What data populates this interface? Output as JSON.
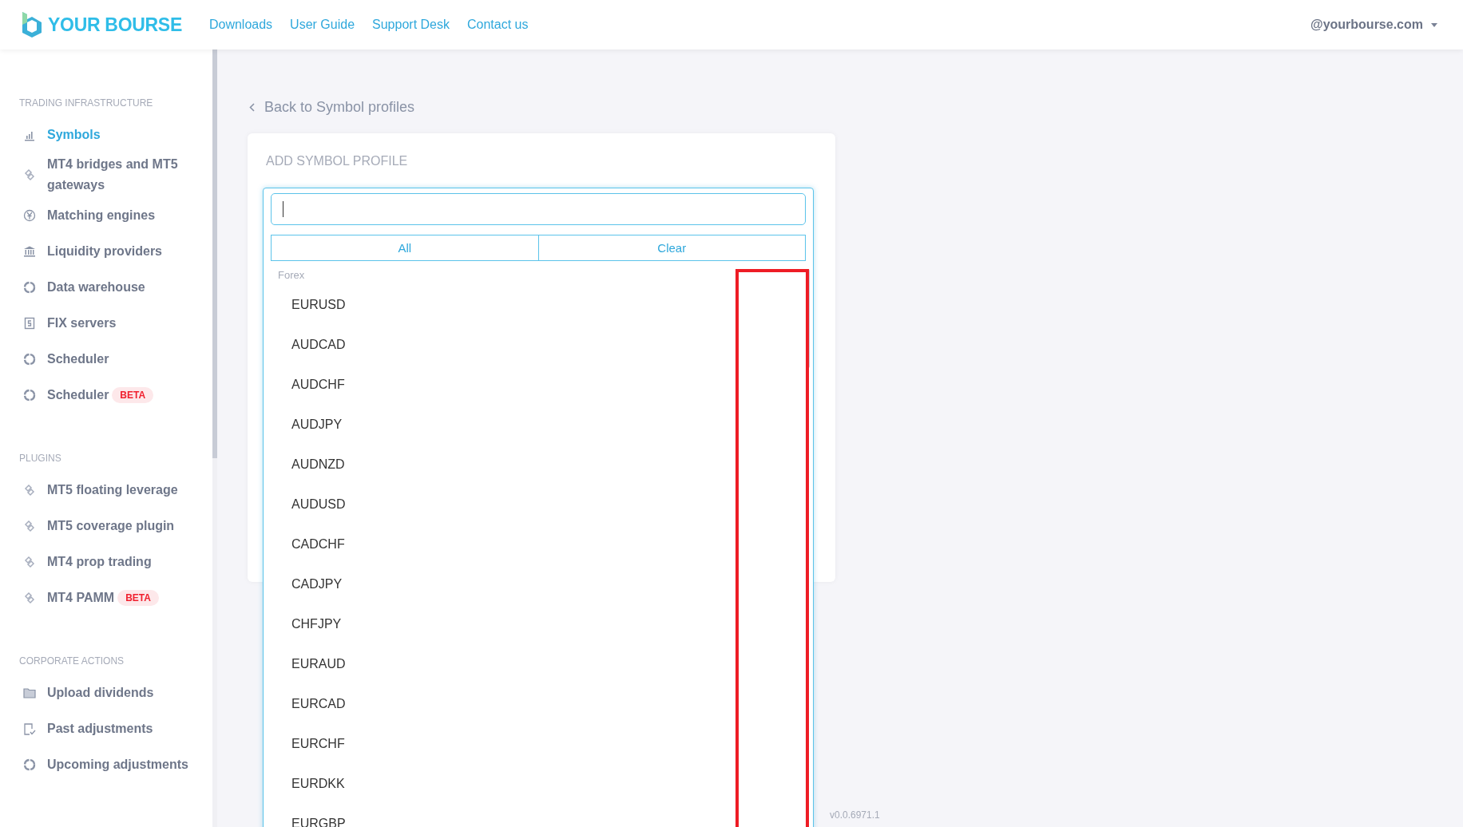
{
  "header": {
    "logo": "YOUR BOURSE",
    "nav": [
      "Downloads",
      "User Guide",
      "Support Desk",
      "Contact us"
    ],
    "account": "@yourbourse.com"
  },
  "sidebar": {
    "sections": [
      {
        "title": "TRADING INFRASTRUCTURE",
        "items": [
          {
            "label": "Symbols",
            "kind": "chart",
            "selected": true
          },
          {
            "label": "MT4 bridges and MT5 gateways",
            "kind": "link",
            "selected": false
          },
          {
            "label": "Matching engines",
            "kind": "yen",
            "selected": false
          },
          {
            "label": "Liquidity providers",
            "kind": "bank",
            "selected": false
          },
          {
            "label": "Data warehouse",
            "kind": "ring",
            "selected": false
          },
          {
            "label": "FIX servers",
            "kind": "server",
            "selected": false
          },
          {
            "label": "Scheduler",
            "kind": "ring",
            "selected": false
          },
          {
            "label": "Scheduler",
            "kind": "ring",
            "selected": false,
            "badge": "BETA"
          }
        ]
      },
      {
        "title": "PLUGINS",
        "items": [
          {
            "label": "MT5 floating leverage",
            "kind": "link",
            "selected": false
          },
          {
            "label": "MT5 coverage plugin",
            "kind": "link",
            "selected": false
          },
          {
            "label": "MT4 prop trading",
            "kind": "link",
            "selected": false
          },
          {
            "label": "MT4 PAMM",
            "kind": "link",
            "selected": false,
            "badge": "BETA"
          }
        ]
      },
      {
        "title": "CORPORATE ACTIONS",
        "items": [
          {
            "label": "Upload dividends",
            "kind": "folder",
            "selected": false
          },
          {
            "label": "Past adjustments",
            "kind": "check",
            "selected": false
          },
          {
            "label": "Upcoming adjustments",
            "kind": "ring",
            "selected": false
          }
        ]
      }
    ]
  },
  "back_link": "Back to Symbol profiles",
  "card": {
    "title": "ADD SYMBOL PROFILE"
  },
  "dropdown": {
    "buttons": [
      "All",
      "Clear"
    ],
    "group": "Forex",
    "options": [
      "EURUSD",
      "AUDCAD",
      "AUDCHF",
      "AUDJPY",
      "AUDNZD",
      "AUDUSD",
      "CADCHF",
      "CADJPY",
      "CHFJPY",
      "EURAUD",
      "EURCAD",
      "EURCHF",
      "EURDKK",
      "EURGBP"
    ]
  },
  "version": "v0.0.6971.1"
}
